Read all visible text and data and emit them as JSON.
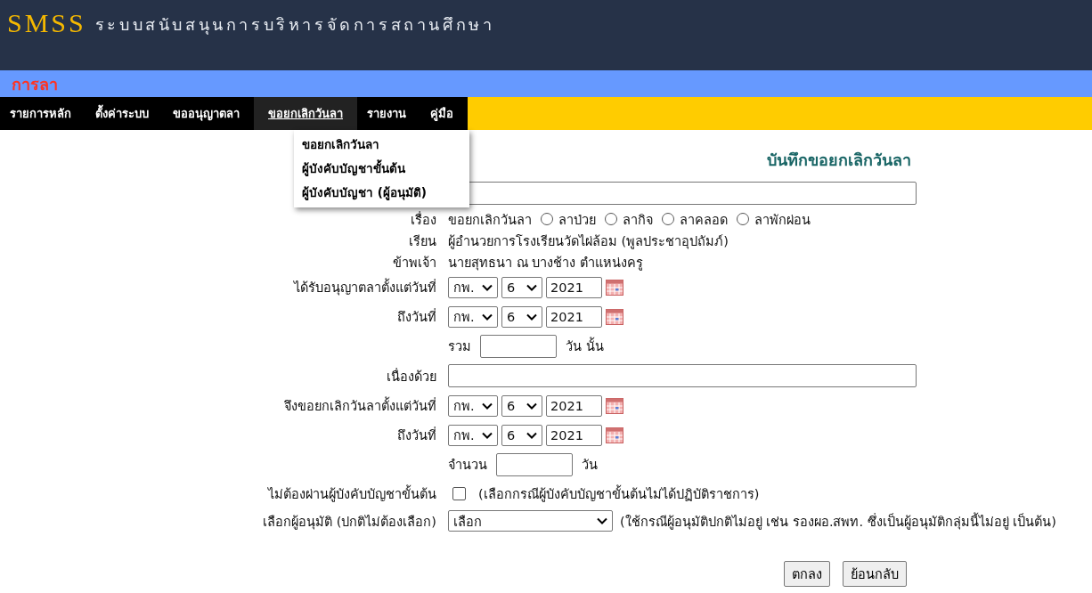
{
  "header": {
    "logo": "SMSS",
    "title": "ระบบสนับสนุนการบริหารจัดการสถานศึกษา"
  },
  "section_bar": {
    "title": "การลา"
  },
  "nav": [
    {
      "label": "รายการหลัก",
      "selected": false
    },
    {
      "label": "ตั้งค่าระบบ",
      "selected": false
    },
    {
      "label": "ขออนุญาตลา",
      "selected": false
    },
    {
      "label": "ขอยกเลิกวันลา",
      "selected": true
    },
    {
      "label": "รายงาน",
      "selected": false
    },
    {
      "label": "คู่มือ",
      "selected": false
    }
  ],
  "dropdown_menu": [
    "ขอยกเลิกวันลา",
    "ผู้บังคับบัญชาขั้นต้น",
    "ผู้บังคับบัญชา (ผู้อนุมัติ)"
  ],
  "form": {
    "title": "บันทึกขอยกเลิกวันลา",
    "rows": [
      {
        "kind": "text",
        "label": ""
      },
      {
        "kind": "subject",
        "label": "เรื่อง",
        "text": "ขอยกเลิกวันลา",
        "options": [
          {
            "label": "ลาป่วย",
            "selected": false
          },
          {
            "label": "ลากิจ",
            "selected": false
          },
          {
            "label": "ลาคลอด",
            "selected": false
          },
          {
            "label": "ลาพักผ่อน",
            "selected": false
          }
        ]
      },
      {
        "kind": "static",
        "label": "เรียน",
        "text": "ผู้อำนวยการโรงเรียนวัดไผ่ล้อม (พูลประชาอุปถัมภ์)"
      },
      {
        "kind": "static",
        "label": "ข้าพเจ้า",
        "text": "นายสุทธนา  ณ บางช้าง  ตำแหน่งครู"
      },
      {
        "kind": "date",
        "label": "ได้รับอนุญาตลาตั้งแต่วันที่",
        "month": "กพ.",
        "day": "6",
        "year": "2021"
      },
      {
        "kind": "date",
        "label": "ถึงวันที่",
        "month": "กพ.",
        "day": "6",
        "year": "2021"
      },
      {
        "kind": "count",
        "label": "",
        "prefix": "รวม",
        "suffix": "วัน นั้น"
      },
      {
        "kind": "text",
        "label": "เนื่องด้วย"
      },
      {
        "kind": "date",
        "label": "จึงขอยกเลิกวันลาตั้งแต่วันที่",
        "month": "กพ.",
        "day": "6",
        "year": "2021"
      },
      {
        "kind": "date",
        "label": "ถึงวันที่",
        "month": "กพ.",
        "day": "6",
        "year": "2021"
      },
      {
        "kind": "count",
        "label": "",
        "prefix": "จำนวน",
        "suffix": "วัน"
      },
      {
        "kind": "checkbox",
        "label": "ไม่ต้องผ่านผู้บังคับบัญชาขั้นต้น",
        "checked": false,
        "note": "(เลือกกรณีผู้บังคับบัญชาขั้นต้นไม่ได้ปฏิบัติราชการ)"
      },
      {
        "kind": "select",
        "label": "เลือกผู้อนุมัติ (ปกติไม่ต้องเลือก)",
        "value": "เลือก",
        "note": "(ใช้กรณีผู้อนุมัติปกติไม่อยู่ เช่น รองผอ.สพท. ซึ่งเป็นผู้อนุมัติกลุ่มนี้ไม่อยู่ เป็นต้น)"
      }
    ],
    "buttons": [
      "ตกลง",
      "ย้อนกลับ"
    ]
  }
}
